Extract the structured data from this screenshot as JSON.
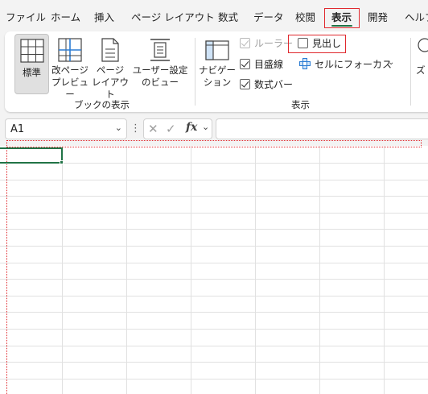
{
  "menu": {
    "tabs": [
      "ファイル",
      "ホーム",
      "挿入",
      "ページ レイアウト",
      "数式",
      "データ",
      "校閲",
      "表示",
      "開発",
      "ヘルプ"
    ],
    "active_tab": "表示"
  },
  "ribbon": {
    "book_views": {
      "group_label": "ブックの表示",
      "normal": "標準",
      "page_break_preview": [
        "改ページ",
        "プレビュー"
      ],
      "page_layout": [
        "ページ",
        "レイアウト"
      ],
      "custom_views": [
        "ユーザー設定",
        "のビュー"
      ]
    },
    "show": {
      "group_label": "表示",
      "navigation": [
        "ナビゲー",
        "ション"
      ],
      "ruler": {
        "label": "ルーラー",
        "checked": true,
        "disabled": true
      },
      "headings": {
        "label": "見出し",
        "checked": false
      },
      "gridlines": {
        "label": "目盛線",
        "checked": true
      },
      "formula_bar": {
        "label": "数式バー",
        "checked": true
      },
      "cell_focus": "セルにフォーカス",
      "zoom_partial": "ズ"
    }
  },
  "formula_bar": {
    "name_box": "A1",
    "fx": "fx",
    "formula": ""
  },
  "colors": {
    "accent_green": "#217346",
    "highlight_red": "#e0292e",
    "gridline": "#e1e1e1"
  }
}
